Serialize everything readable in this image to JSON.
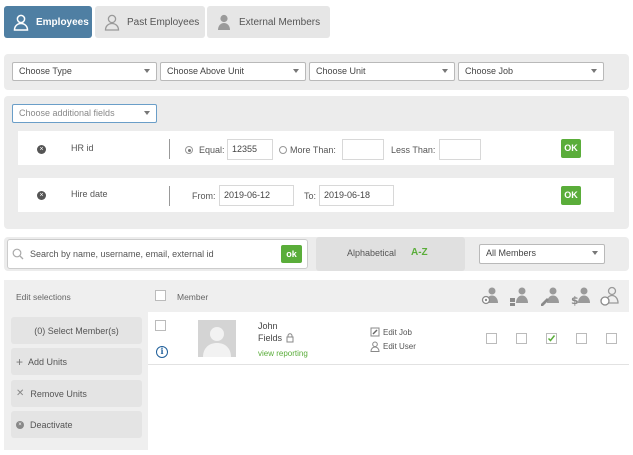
{
  "tabs": [
    {
      "label": "Employees",
      "icon": "user-icon",
      "active": true
    },
    {
      "label": "Past Employees",
      "icon": "user-outline-icon",
      "active": false
    },
    {
      "label": "External Members",
      "icon": "user-silhouette-icon",
      "active": false
    }
  ],
  "filters": {
    "type": "Choose Type",
    "above_unit": "Choose Above Unit",
    "unit": "Choose Unit",
    "job": "Choose Job"
  },
  "additional_fields": {
    "placeholder": "Choose additional fields",
    "rows": [
      {
        "name": "HR id",
        "equal_label": "Equal:",
        "equal_value": "12355",
        "more_label": "More Than:",
        "more_value": "",
        "less_label": "Less Than:",
        "less_value": "",
        "ok": "OK"
      },
      {
        "name": "Hire date",
        "from_label": "From:",
        "from_value": "2019-06-12",
        "to_label": "To:",
        "to_value": "2019-06-18",
        "ok": "OK"
      }
    ]
  },
  "search": {
    "placeholder": "Search by name, username, email, external id",
    "ok": "ok"
  },
  "sort": {
    "label": "Alphabetical",
    "az": "A-Z"
  },
  "members_filter": "All Members",
  "sidebar": {
    "title": "Edit selections",
    "buttons": [
      {
        "label": "(0) Select Member(s)",
        "icon": ""
      },
      {
        "label": "Add Units",
        "icon": "plus-icon"
      },
      {
        "label": "Remove Units",
        "icon": "x-icon"
      },
      {
        "label": "Deactivate",
        "icon": "x-circle-icon"
      }
    ]
  },
  "table": {
    "member_header": "Member",
    "column_icons": [
      "user-settings-icon",
      "user-hierarchy-icon",
      "user-edit-icon",
      "user-salary-icon",
      "user-compare-icon"
    ],
    "rows": [
      {
        "first_name": "John",
        "last_name": "Fields",
        "link": "view reporting",
        "edit_job": "Edit Job",
        "edit_user": "Edit User",
        "checks": [
          false,
          false,
          true,
          false,
          false
        ]
      }
    ]
  },
  "colors": {
    "active_tab": "#4f7fa3",
    "ok_green": "#5aad3a",
    "panel": "#ececec"
  }
}
